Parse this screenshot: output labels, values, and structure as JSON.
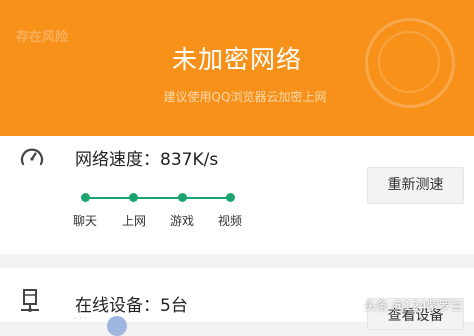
{
  "banner": {
    "title": "未加密网络",
    "subtitle": "建议使用QQ浏览器云加密上网",
    "stamp_text": "存在风险",
    "color": "#f7911a"
  },
  "speed": {
    "icon": "speedometer-icon",
    "label": "网络速度：837K/s",
    "levels": [
      "聊天",
      "上网",
      "游戏",
      "视频"
    ],
    "accent": "#1aa56f",
    "retest_button": "重新测速"
  },
  "devices": {
    "icon": "network-device-icon",
    "label": "在线设备：5台",
    "view_button": "查看设备"
  },
  "watermark": "头条 @124紫罗兰"
}
